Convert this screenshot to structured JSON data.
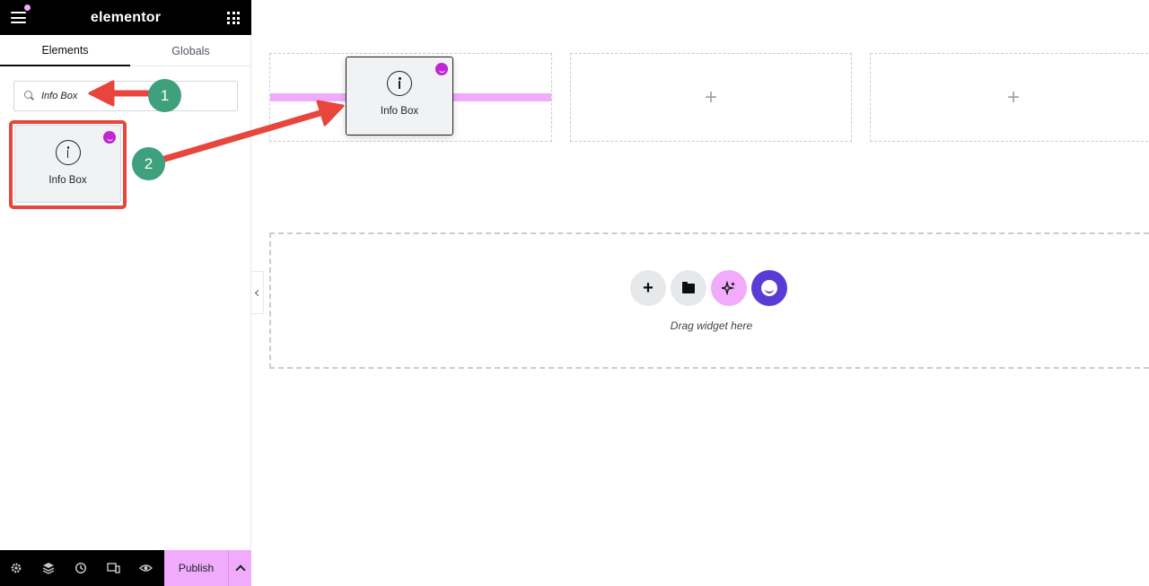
{
  "app": {
    "brand": "elementor"
  },
  "sidebar": {
    "tabs": [
      {
        "label": "Elements",
        "active": true
      },
      {
        "label": "Globals",
        "active": false
      }
    ],
    "search": {
      "value": "Info Box",
      "icon": "search-icon"
    },
    "widget": {
      "label": "Info Box",
      "icon": "info-circle-icon",
      "badge_icon": "pro-badge-icon"
    },
    "bottombar": {
      "icons": [
        "gear-icon",
        "layers-icon",
        "history-icon",
        "responsive-icon",
        "eye-icon"
      ],
      "publish_label": "Publish"
    }
  },
  "canvas": {
    "columns": [
      {
        "content": "drop-target"
      },
      {
        "content": "+"
      },
      {
        "content": "+"
      }
    ],
    "drag_ghost": {
      "label": "Info Box"
    },
    "empty_section": {
      "buttons": [
        "add-icon",
        "folder-icon",
        "ai-sparkle-icon",
        "essential-addons-icon"
      ],
      "hint": "Drag widget here"
    }
  },
  "annotations": {
    "steps": [
      "1",
      "2"
    ],
    "arrow_color": "#e8453c",
    "badge_color": "#3ea07d"
  },
  "colors": {
    "accent_pink": "#f0abfc",
    "topbar": "#000000",
    "highlight": "#e8453c",
    "ea_purple": "#5b3bd6"
  }
}
